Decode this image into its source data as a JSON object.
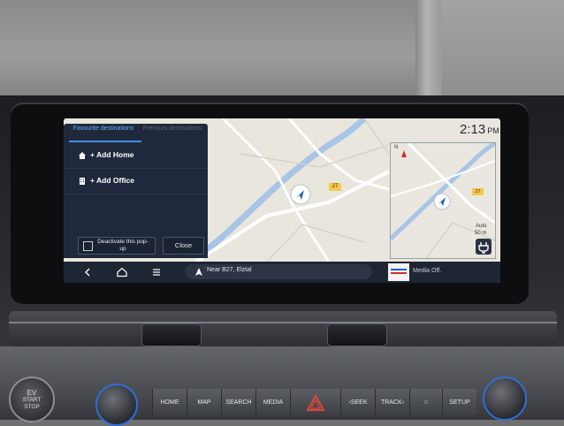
{
  "status": {
    "time": "2:13",
    "ampm": "PM"
  },
  "popup": {
    "tabs": [
      "Favourite destinations",
      "Previous destinations"
    ],
    "items": [
      {
        "icon": "home-icon",
        "label": "+ Add Home"
      },
      {
        "icon": "office-icon",
        "label": "+ Add Office"
      }
    ],
    "deactivate_label": "Deactivate this pop-up",
    "close_label": "Close"
  },
  "map": {
    "road_badge": "27",
    "mini_road_badge": "27",
    "compass": "N",
    "zoom_mode": "Auto",
    "scale": "50 m"
  },
  "navbar": {
    "back_icon": "chevron-left-icon",
    "home_icon": "home-outline-icon",
    "menu_icon": "menu-icon",
    "location_text": "Near B27, Elztal",
    "media_text": "Media Off."
  },
  "console": {
    "ev_lines": [
      "EV",
      "START",
      "STOP"
    ],
    "buttons": [
      "HOME",
      "MAP",
      "SEARCH",
      "MEDIA",
      "",
      "‹SEEK",
      "TRACK›",
      "☆",
      "SETUP"
    ]
  }
}
